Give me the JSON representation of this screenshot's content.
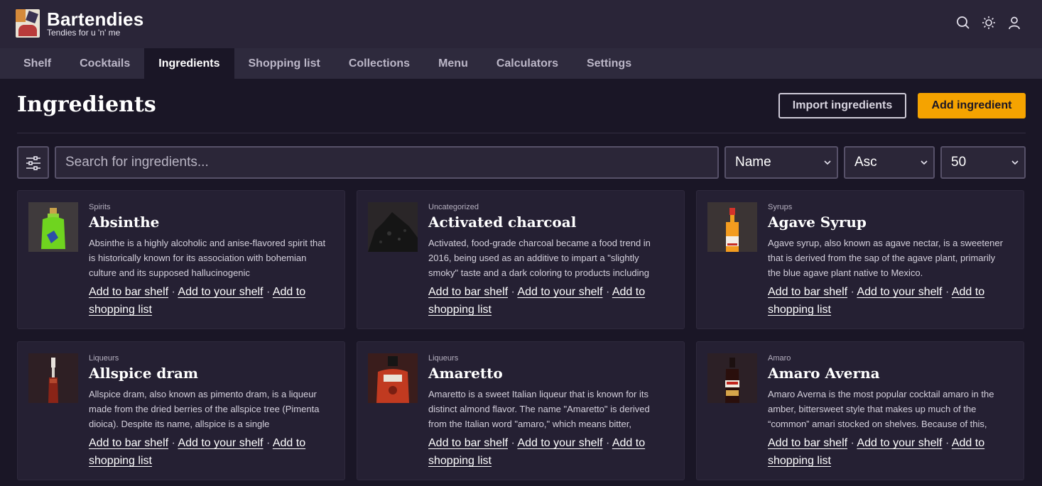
{
  "header": {
    "brand": "Bartendies",
    "tagline": "Tendies for u 'n' me",
    "icons": [
      "search-icon",
      "theme-sun-icon",
      "user-icon"
    ]
  },
  "nav": {
    "items": [
      {
        "label": "Shelf"
      },
      {
        "label": "Cocktails"
      },
      {
        "label": "Ingredients",
        "active": true
      },
      {
        "label": "Shopping list"
      },
      {
        "label": "Collections"
      },
      {
        "label": "Menu"
      },
      {
        "label": "Calculators"
      },
      {
        "label": "Settings"
      }
    ]
  },
  "page": {
    "title": "Ingredients",
    "import_label": "Import ingredients",
    "add_label": "Add ingredient"
  },
  "controls": {
    "search_placeholder": "Search for ingredients...",
    "sort_field": "Name",
    "sort_dir": "Asc",
    "per_page": "50"
  },
  "colors": {
    "accent": "#f5a300",
    "background": "#1a1626",
    "card": "#252033"
  },
  "cards": [
    {
      "category": "Spirits",
      "name": "Absinthe",
      "desc": "Absinthe is a highly alcoholic and anise-flavored spirit that is historically known for its association with bohemian culture and its supposed hallucinogenic",
      "link1": "Add to bar shelf",
      "link2": "Add to your shelf",
      "link3": "Add to shopping list"
    },
    {
      "category": "Uncategorized",
      "name": "Activated charcoal",
      "desc": "Activated, food-grade charcoal became a food trend in 2016, being used as an additive to impart a \"slightly smoky\" taste and a dark coloring to products including",
      "link1": "Add to bar shelf",
      "link2": "Add to your shelf",
      "link3": "Add to shopping list"
    },
    {
      "category": "Syrups",
      "name": "Agave Syrup",
      "desc": "Agave syrup, also known as agave nectar, is a sweetener that is derived from the sap of the agave plant, primarily the blue agave plant native to Mexico.",
      "link1": "Add to bar shelf",
      "link2": "Add to your shelf",
      "link3": "Add to shopping list"
    },
    {
      "category": "Liqueurs",
      "name": "Allspice dram",
      "desc": "Allspice dram, also known as pimento dram, is a liqueur made from the dried berries of the allspice tree (Pimenta dioica). Despite its name, allspice is a single",
      "link1": "Add to bar shelf",
      "link2": "Add to your shelf",
      "link3": "Add to shopping list"
    },
    {
      "category": "Liqueurs",
      "name": "Amaretto",
      "desc": "Amaretto is a sweet Italian liqueur that is known for its distinct almond flavor. The name \"Amaretto\" is derived from the Italian word \"amaro,\" which means bitter,",
      "link1": "Add to bar shelf",
      "link2": "Add to your shelf",
      "link3": "Add to shopping list"
    },
    {
      "category": "Amaro",
      "name": "Amaro Averna",
      "desc": "Amaro Averna is the most popular cocktail amaro in the amber, bittersweet style that makes up much of the “common” amari stocked on shelves. Because of this,",
      "link1": "Add to bar shelf",
      "link2": "Add to your shelf",
      "link3": "Add to shopping list"
    }
  ]
}
